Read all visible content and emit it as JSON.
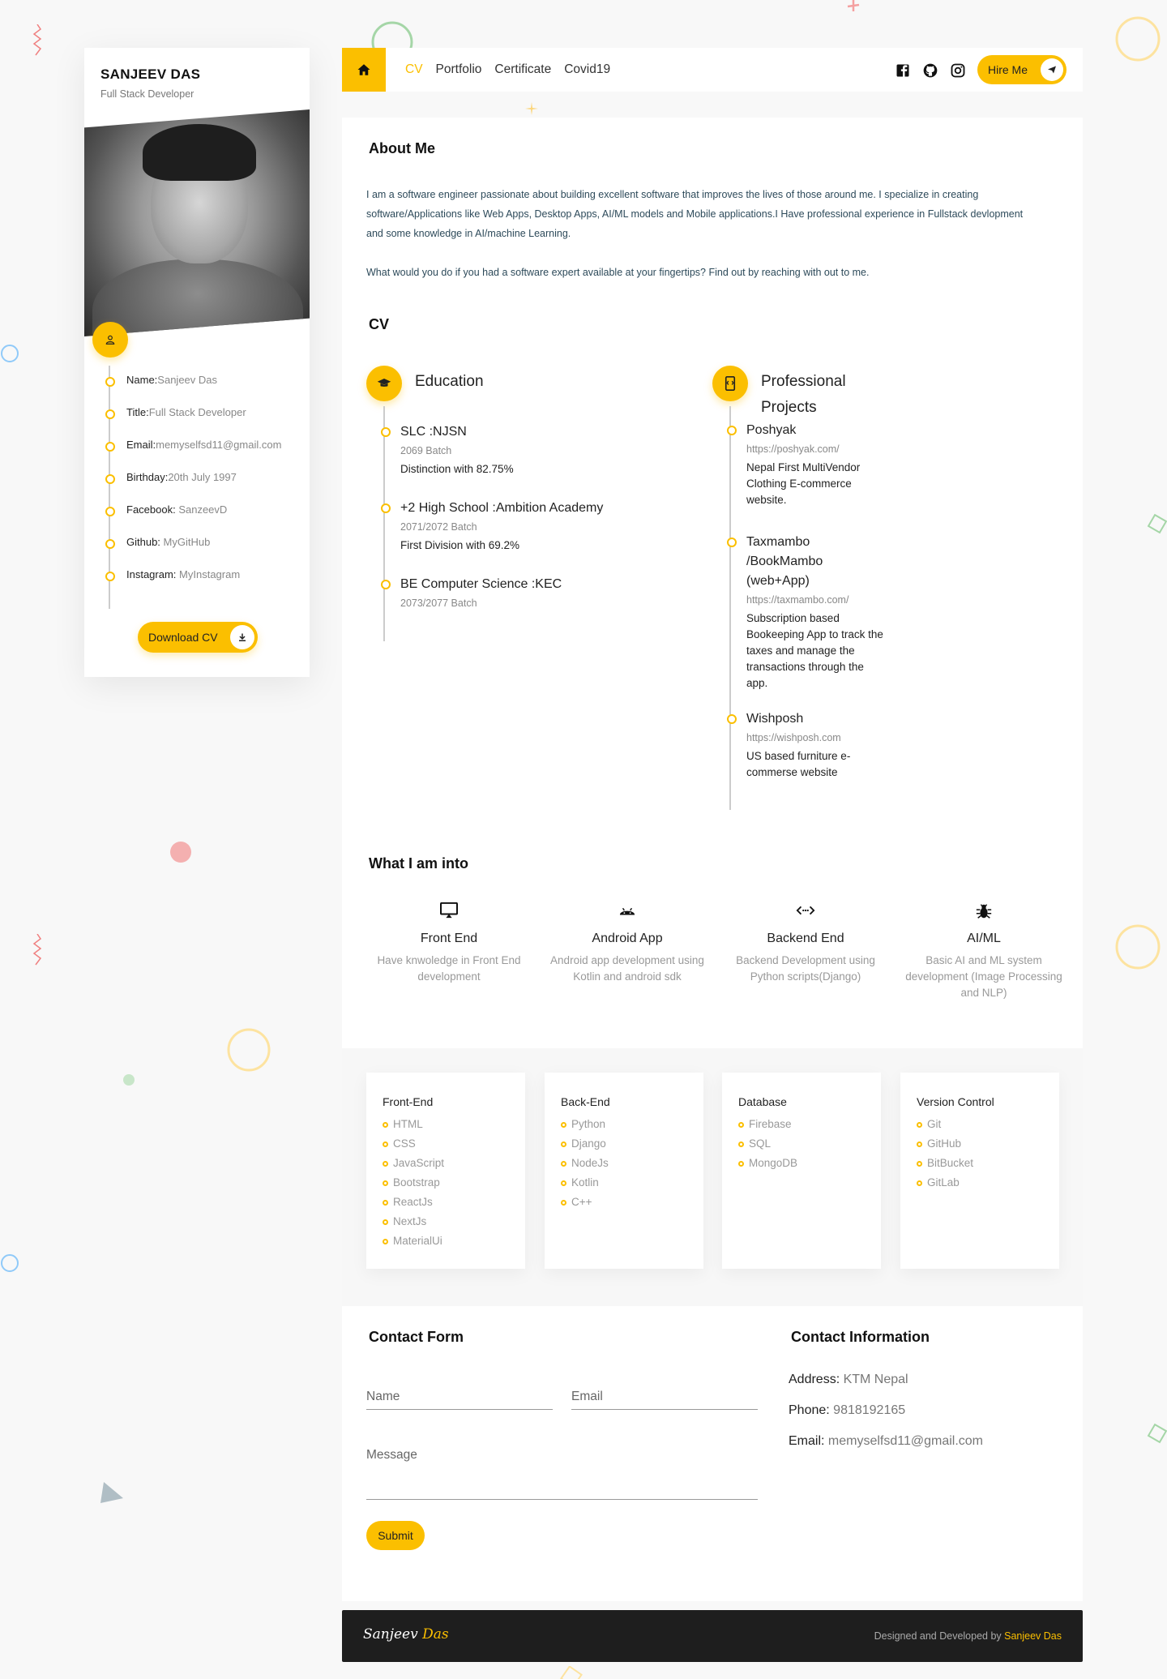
{
  "colors": {
    "accent": "#fbbf00",
    "dark": "#1e1e1e"
  },
  "profile": {
    "name": "SANJEEV DAS",
    "role": "Full Stack Developer",
    "info": [
      {
        "label": "Name:",
        "value": "Sanjeev Das"
      },
      {
        "label": "Title:",
        "value": "Full Stack Developer"
      },
      {
        "label": "Email:",
        "value": "memyselfsd11@gmail.com"
      },
      {
        "label": "Birthday:",
        "value": "20th July 1997"
      },
      {
        "label": "Facebook:",
        "value": " SanzeevD"
      },
      {
        "label": "Github:",
        "value": " MyGitHub"
      },
      {
        "label": "Instagram:",
        "value": " MyInstagram"
      }
    ],
    "download_label": "Download CV"
  },
  "nav": {
    "links": [
      "CV",
      "Portfolio",
      "Certificate",
      "Covid19"
    ],
    "active": "CV",
    "social_icons": [
      "facebook-icon",
      "github-icon",
      "instagram-icon"
    ],
    "hire_label": "Hire Me"
  },
  "about": {
    "title": "About Me",
    "paragraphs": [
      "I am a software engineer passionate about building excellent software that improves the lives of those around me. I specialize in creating software/Applications like Web Apps, Desktop Apps, AI/ML models and Mobile applications.I Have professional experience in Fullstack devlopment and some knowledge in AI/machine Learning.",
      "What would you do if you had a software expert available at your fingertips? Find out by reaching with out to me."
    ]
  },
  "cv": {
    "title": "CV",
    "education": {
      "title": "Education",
      "items": [
        {
          "title": "SLC :NJSN",
          "sub": "2069 Batch",
          "desc": "Distinction with 82.75%"
        },
        {
          "title": "+2 High School :Ambition Academy",
          "sub": "2071/2072 Batch",
          "desc": "First Division with 69.2%"
        },
        {
          "title": "BE Computer Science :KEC",
          "sub": "2073/2077 Batch",
          "desc": ""
        }
      ]
    },
    "projects": {
      "title": "Professional Projects",
      "items": [
        {
          "title": "Poshyak",
          "sub": "https://poshyak.com/",
          "desc": "Nepal First MultiVendor Clothing E-commerce website."
        },
        {
          "title": "Taxmambo /BookMambo (web+App)",
          "sub": "https://taxmambo.com/",
          "desc": "Subscription based Bookeeping App to track the taxes and manage the transactions through the app."
        },
        {
          "title": "Wishposh",
          "sub": "https://wishposh.com",
          "desc": "US based furniture e-commerse website"
        }
      ]
    }
  },
  "into": {
    "title": "What I am into",
    "items": [
      {
        "icon": "monitor-icon",
        "title": "Front End",
        "desc": "Have knwoledge in Front End development"
      },
      {
        "icon": "android-icon",
        "title": "Android App",
        "desc": "Android app development using Kotlin and android sdk"
      },
      {
        "icon": "code-icon",
        "title": "Backend End",
        "desc": "Backend Development using Python scripts(Django)"
      },
      {
        "icon": "bug-icon",
        "title": "AI/ML",
        "desc": "Basic AI and ML system development (Image Processing and NLP)"
      }
    ]
  },
  "skills": [
    {
      "title": "Front-End",
      "items": [
        "HTML",
        "CSS",
        "JavaScript",
        "Bootstrap",
        "ReactJs",
        "NextJs",
        "MaterialUi"
      ]
    },
    {
      "title": "Back-End",
      "items": [
        "Python",
        "Django",
        "NodeJs",
        "Kotlin",
        "C++"
      ]
    },
    {
      "title": "Database",
      "items": [
        "Firebase",
        "SQL",
        "MongoDB"
      ]
    },
    {
      "title": "Version Control",
      "items": [
        "Git",
        "GitHub",
        "BitBucket",
        "GitLab"
      ]
    }
  ],
  "contact_form": {
    "title": "Contact Form",
    "name_placeholder": "Name",
    "email_placeholder": "Email",
    "message_placeholder": "Message",
    "submit_label": "Submit"
  },
  "contact_info": {
    "title": "Contact Information",
    "rows": [
      {
        "label": "Address:",
        "value": " KTM Nepal"
      },
      {
        "label": "Phone:",
        "value": " 9818192165"
      },
      {
        "label": "Email:",
        "value": " memyselfsd11@gmail.com"
      }
    ]
  },
  "footer": {
    "logo_first": "Sanjeev",
    "logo_last": "Das",
    "credit_prefix": "Designed and Developed by ",
    "credit_name": "Sanjeev Das"
  }
}
